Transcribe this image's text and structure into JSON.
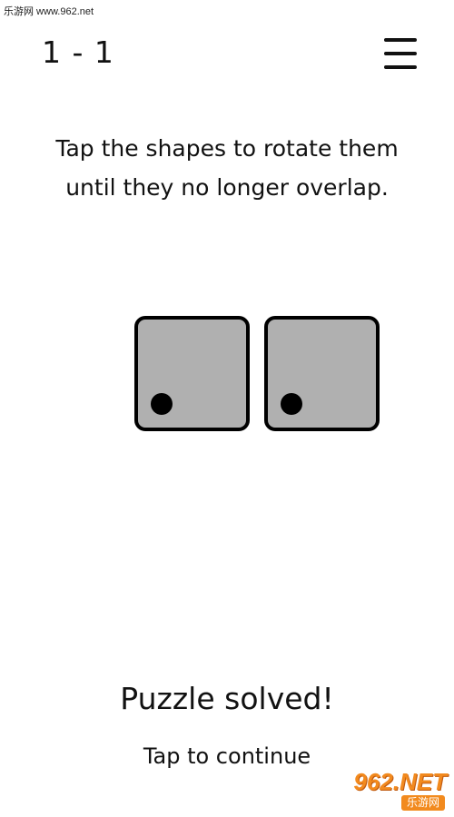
{
  "watermark": {
    "top_text": "乐游网 www.962.net",
    "logo_text": "962.NET",
    "logo_subtext": "乐游网"
  },
  "header": {
    "level": "1 - 1",
    "menu_icon": "hamburger-menu-icon"
  },
  "instructions": {
    "line1": "Tap the shapes to rotate them",
    "line2": "until they no longer overlap."
  },
  "puzzle": {
    "shapes": [
      {
        "name": "square",
        "fill": "#b0b0b0",
        "border": "#000000",
        "marker": "dot"
      },
      {
        "name": "square",
        "fill": "#b0b0b0",
        "border": "#000000",
        "marker": "dot"
      }
    ]
  },
  "status": {
    "solved_text": "Puzzle solved!",
    "continue_text": "Tap to continue"
  },
  "colors": {
    "background": "#ffffff",
    "text": "#111111",
    "shape_fill": "#b0b0b0",
    "logo_accent": "#f28a1e"
  }
}
